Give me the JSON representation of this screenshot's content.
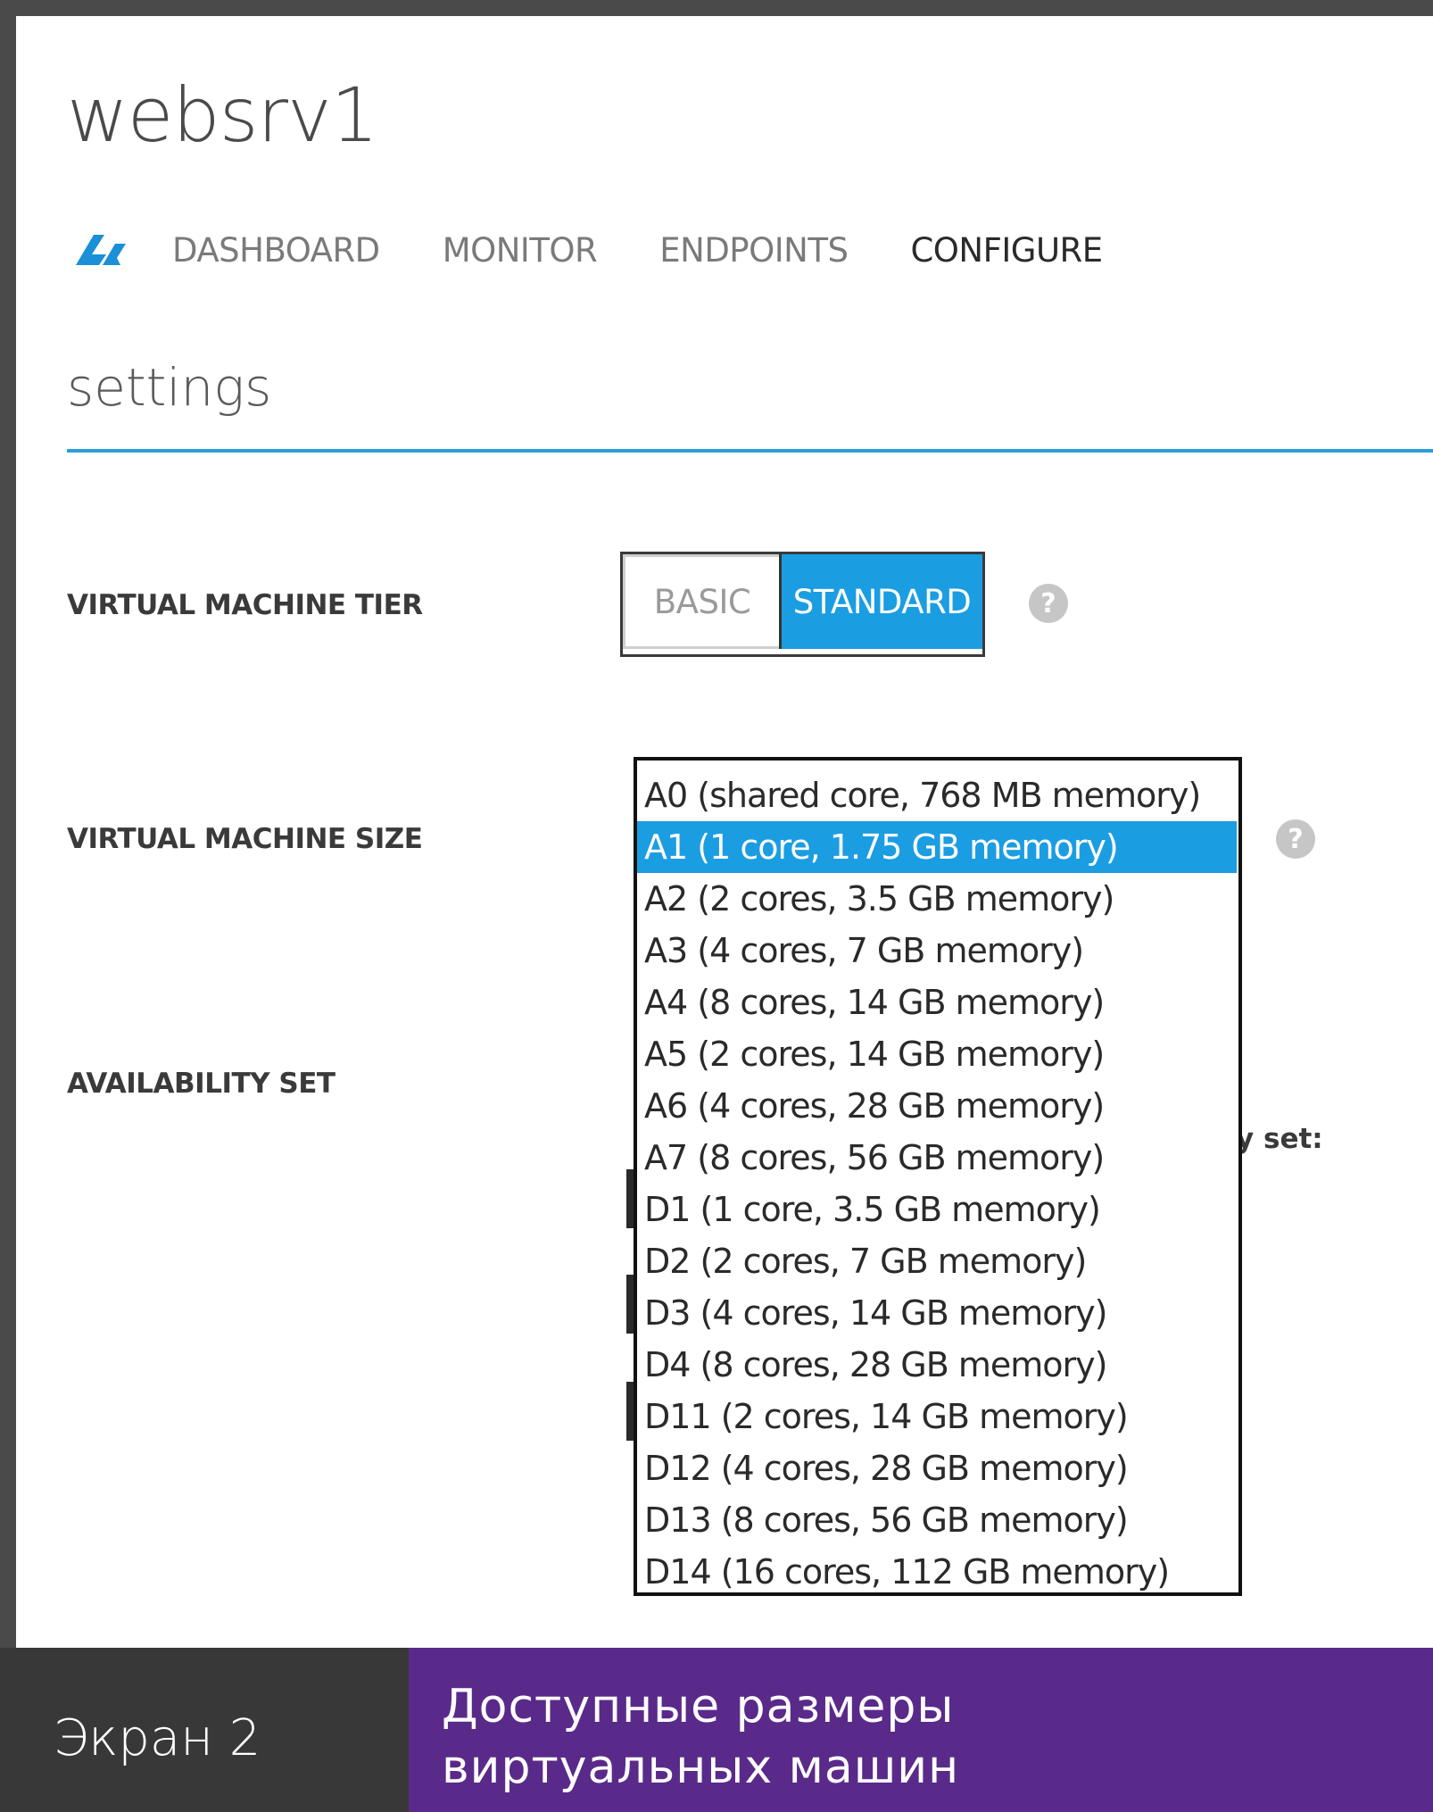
{
  "vm": {
    "title": "websrv1"
  },
  "nav": {
    "icon": "cloud-service-icon",
    "tabs": [
      "DASHBOARD",
      "MONITOR",
      "ENDPOINTS",
      "CONFIGURE"
    ],
    "active_tab": "CONFIGURE"
  },
  "settings": {
    "heading": "settings"
  },
  "tier": {
    "label": "VIRTUAL MACHINE TIER",
    "options": [
      "BASIC",
      "STANDARD"
    ],
    "selected": "STANDARD",
    "help": "?"
  },
  "size": {
    "label": "VIRTUAL MACHINE SIZE",
    "help": "?",
    "selected": "A1 (1 core, 1.75 GB memory)",
    "options": [
      "A0 (shared core, 768 MB memory)",
      "A1 (1 core, 1.75 GB memory)",
      "A2 (2 cores, 3.5 GB memory)",
      "A3 (4 cores, 7 GB memory)",
      "A4 (8 cores, 14 GB memory)",
      "A5 (2 cores, 14 GB memory)",
      "A6 (4 cores, 28 GB memory)",
      "A7 (8 cores, 56 GB memory)",
      "D1 (1 core, 3.5 GB memory)",
      "D2 (2 cores, 7 GB memory)",
      "D3 (4 cores, 14 GB memory)",
      "D4 (8 cores, 28 GB memory)",
      "D11 (2 cores, 14 GB memory)",
      "D12 (4 cores, 28 GB memory)",
      "D13 (8 cores, 56 GB memory)",
      "D14 (16 cores, 112 GB memory)"
    ]
  },
  "availability": {
    "label": "AVAILABILITY SET",
    "partial_text": "y set:"
  },
  "caption": {
    "number": "Экран 2",
    "text_line1": "Доступные размеры",
    "text_line2": "виртуальных машин"
  },
  "colors": {
    "accent": "#1b9de2",
    "rule": "#2b9fd8",
    "caption_purple": "#5a2a8a",
    "caption_dark": "#383838"
  }
}
